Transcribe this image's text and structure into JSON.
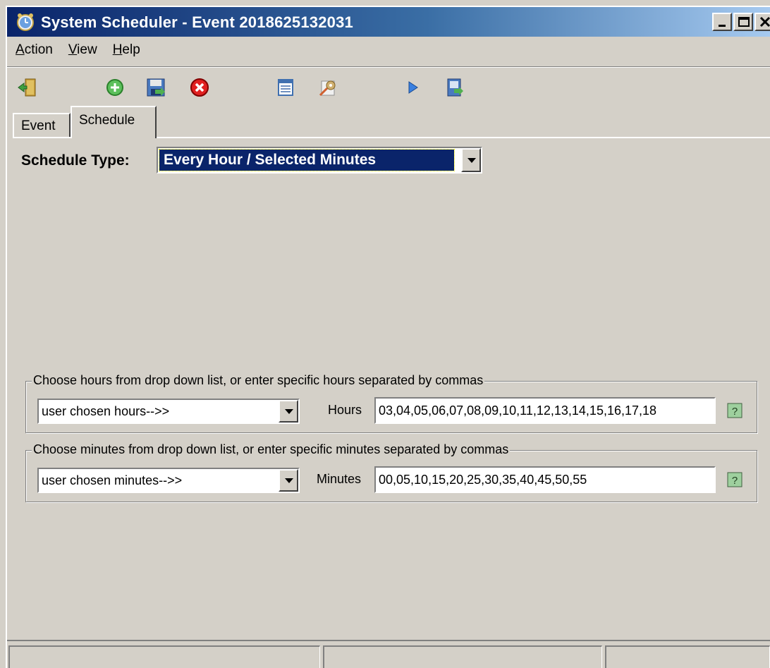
{
  "window": {
    "title": "System Scheduler - Event 2018625132031",
    "app_icon": "alarm-clock-icon",
    "controls": [
      "minimize-icon",
      "maximize-icon",
      "close-icon"
    ]
  },
  "menu": {
    "items": [
      {
        "label": "Action",
        "underline": "A",
        "rest": "ction"
      },
      {
        "label": "View",
        "underline": "V",
        "rest": "iew"
      },
      {
        "label": "Help",
        "underline": "H",
        "rest": "elp"
      }
    ]
  },
  "toolbar": {
    "icons": [
      "exit-door-icon",
      "add-icon",
      "save-icon",
      "delete-icon",
      "list-icon",
      "settings-icon",
      "run-icon",
      "export-icon"
    ]
  },
  "tabs": {
    "event_label": "Event",
    "schedule_label": "Schedule",
    "active": "Schedule"
  },
  "schedule": {
    "type_label": "Schedule Type:",
    "type_value": "Every Hour / Selected Minutes"
  },
  "hours_group": {
    "legend": "Choose hours from drop down list, or enter specific hours separated by commas",
    "dropdown_value": "user chosen hours-->>",
    "field_label": "Hours",
    "field_value": "03,04,05,06,07,08,09,10,11,12,13,14,15,16,17,18"
  },
  "minutes_group": {
    "legend": "Choose minutes from drop down list, or enter specific minutes separated by commas",
    "dropdown_value": "user chosen minutes-->>",
    "field_label": "Minutes",
    "field_value": "00,05,10,15,20,25,30,35,40,45,50,55"
  },
  "colors": {
    "face": "#d4d0c8",
    "selection": "#0a246a",
    "title_start": "#0a246a",
    "title_end": "#a6caf0"
  }
}
